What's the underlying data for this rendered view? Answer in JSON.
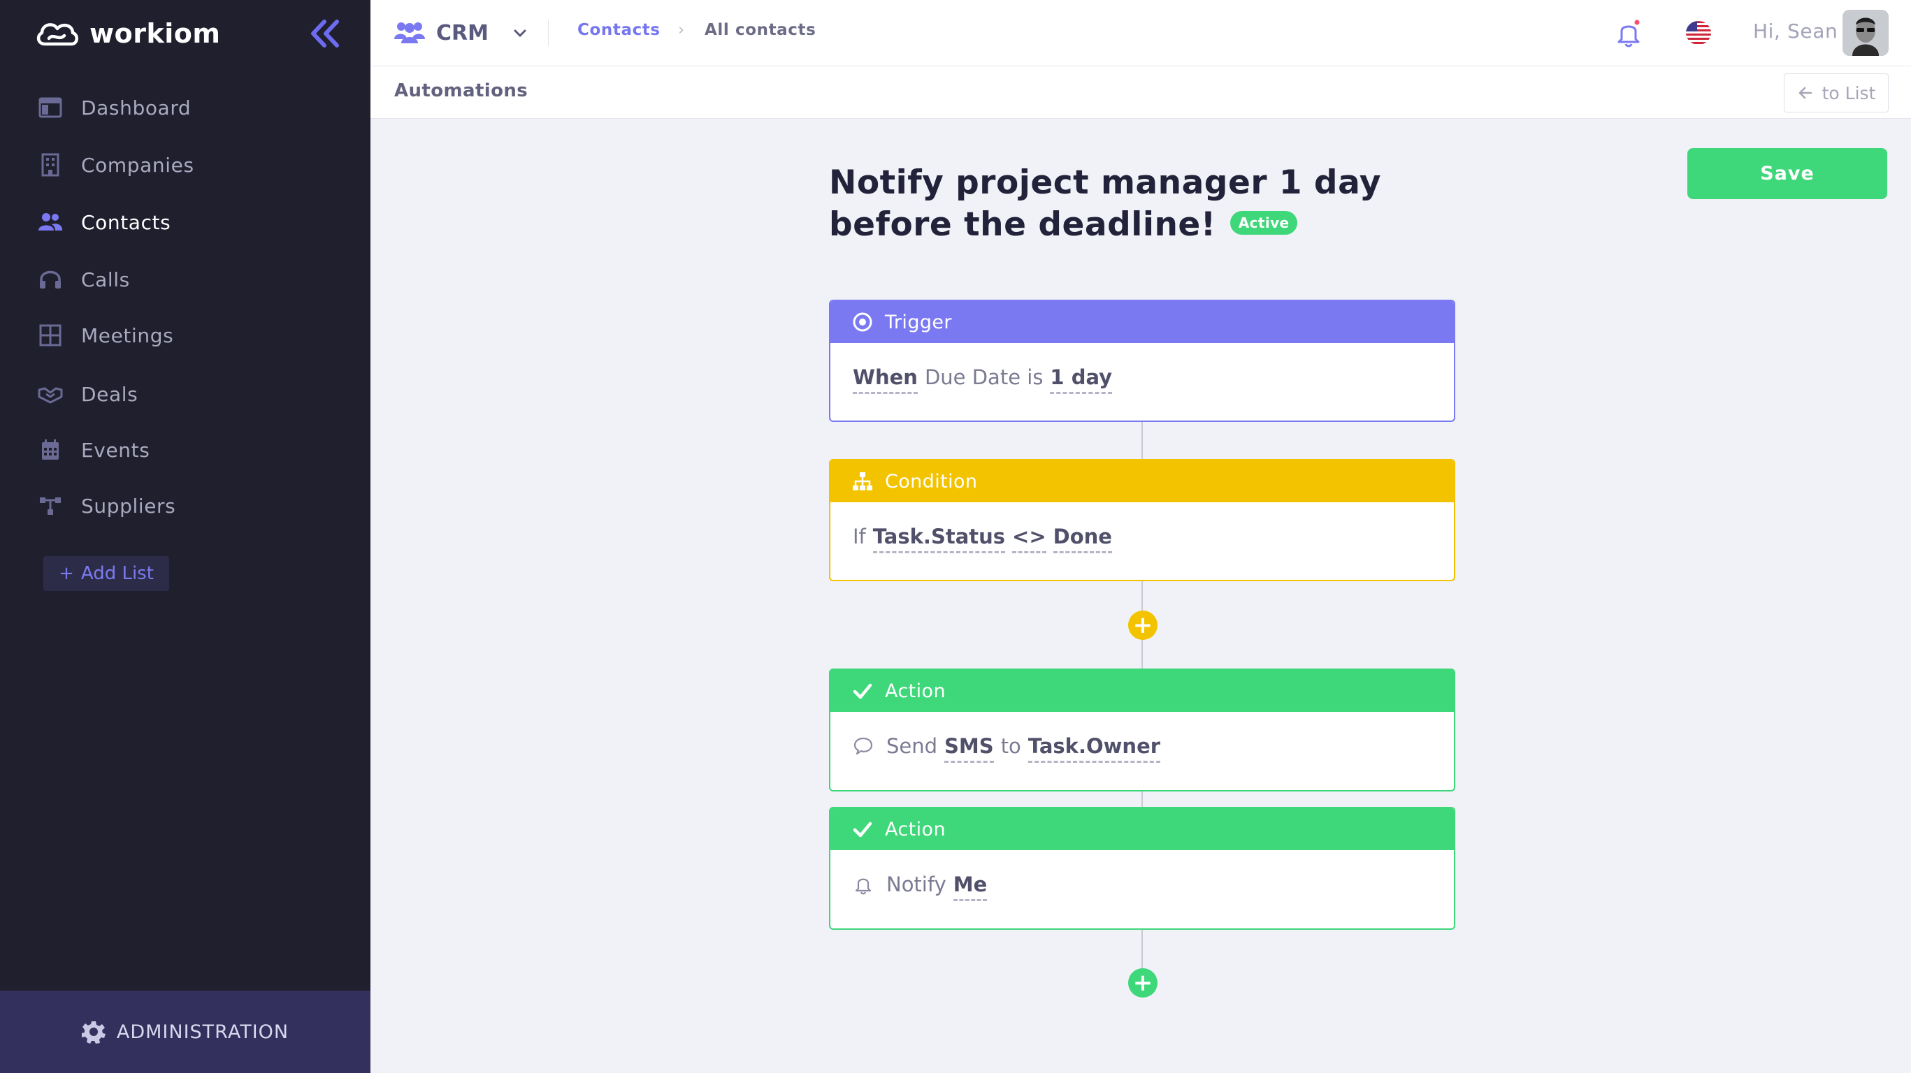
{
  "app": {
    "brand": "workiom",
    "colors": {
      "accent": "#7b79f2",
      "condition": "#f3c300",
      "action": "#3ed779",
      "sidebar": "#1f1f2e"
    }
  },
  "sidebar": {
    "items": [
      {
        "label": "Dashboard",
        "icon": "dashboard-icon"
      },
      {
        "label": "Companies",
        "icon": "building-icon"
      },
      {
        "label": "Contacts",
        "icon": "users-icon",
        "active": true
      },
      {
        "label": "Calls",
        "icon": "headset-icon"
      },
      {
        "label": "Meetings",
        "icon": "grid-icon"
      },
      {
        "label": "Deals",
        "icon": "handshake-icon"
      },
      {
        "label": "Events",
        "icon": "calendar-icon"
      },
      {
        "label": "Suppliers",
        "icon": "network-icon"
      }
    ],
    "add_list": "Add List",
    "add_list_icon": "+",
    "admin_label": "ADMINISTRATION"
  },
  "topbar": {
    "app_name": "CRM",
    "breadcrumb": [
      "Contacts",
      "All contacts"
    ],
    "breadcrumb_sep": "›",
    "greeting": "Hi, Sean"
  },
  "subbar": {
    "title": "Automations",
    "to_list": "to List"
  },
  "main": {
    "save_label": "Save",
    "title": "Notify project manager 1 day before the deadline!",
    "status": "Active",
    "trigger": {
      "header": "Trigger",
      "when": "When",
      "field": "Due Date is",
      "value": "1 day"
    },
    "condition": {
      "header": "Condition",
      "if": "If",
      "field": "Task.Status",
      "operator": "<>",
      "value": "Done"
    },
    "action1": {
      "header": "Action",
      "verb": "Send",
      "channel": "SMS",
      "to": "to",
      "target": "Task.Owner"
    },
    "action2": {
      "header": "Action",
      "verb": "Notify",
      "target": "Me"
    },
    "add_step": "+"
  }
}
